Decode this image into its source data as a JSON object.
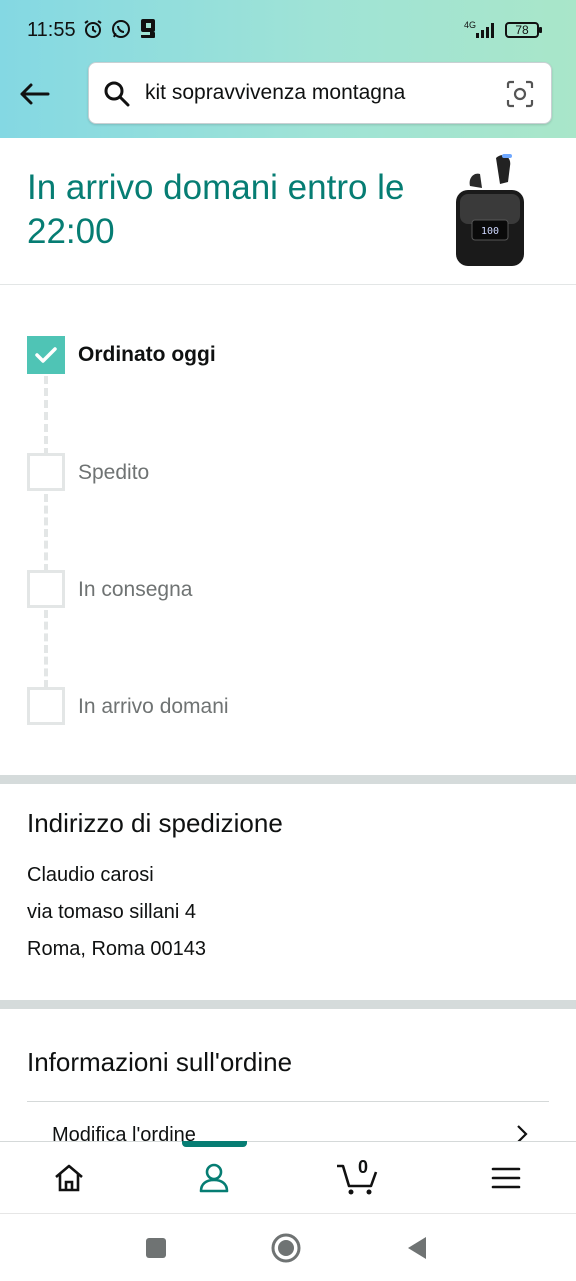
{
  "status_bar": {
    "time": "11:55",
    "network": "4G",
    "battery": "78"
  },
  "search": {
    "query": "kit sopravvivenza montagna"
  },
  "delivery": {
    "title": "In arrivo domani entro le 22:00"
  },
  "tracking": {
    "steps": [
      {
        "label": "Ordinato oggi",
        "done": true
      },
      {
        "label": "Spedito",
        "done": false
      },
      {
        "label": "In consegna",
        "done": false
      },
      {
        "label": "In arrivo domani",
        "done": false
      }
    ]
  },
  "shipping": {
    "title": "Indirizzo di spedizione",
    "name": "Claudio carosi",
    "street": "via tomaso sillani 4",
    "city": "Roma, Roma 00143"
  },
  "order_info": {
    "title": "Informazioni sull'ordine",
    "modify_label": "Modifica l'ordine"
  },
  "bottom_nav": {
    "cart_count": "0",
    "active": "account"
  },
  "colors": {
    "accent": "#067d73",
    "check": "#4fc4b5"
  }
}
